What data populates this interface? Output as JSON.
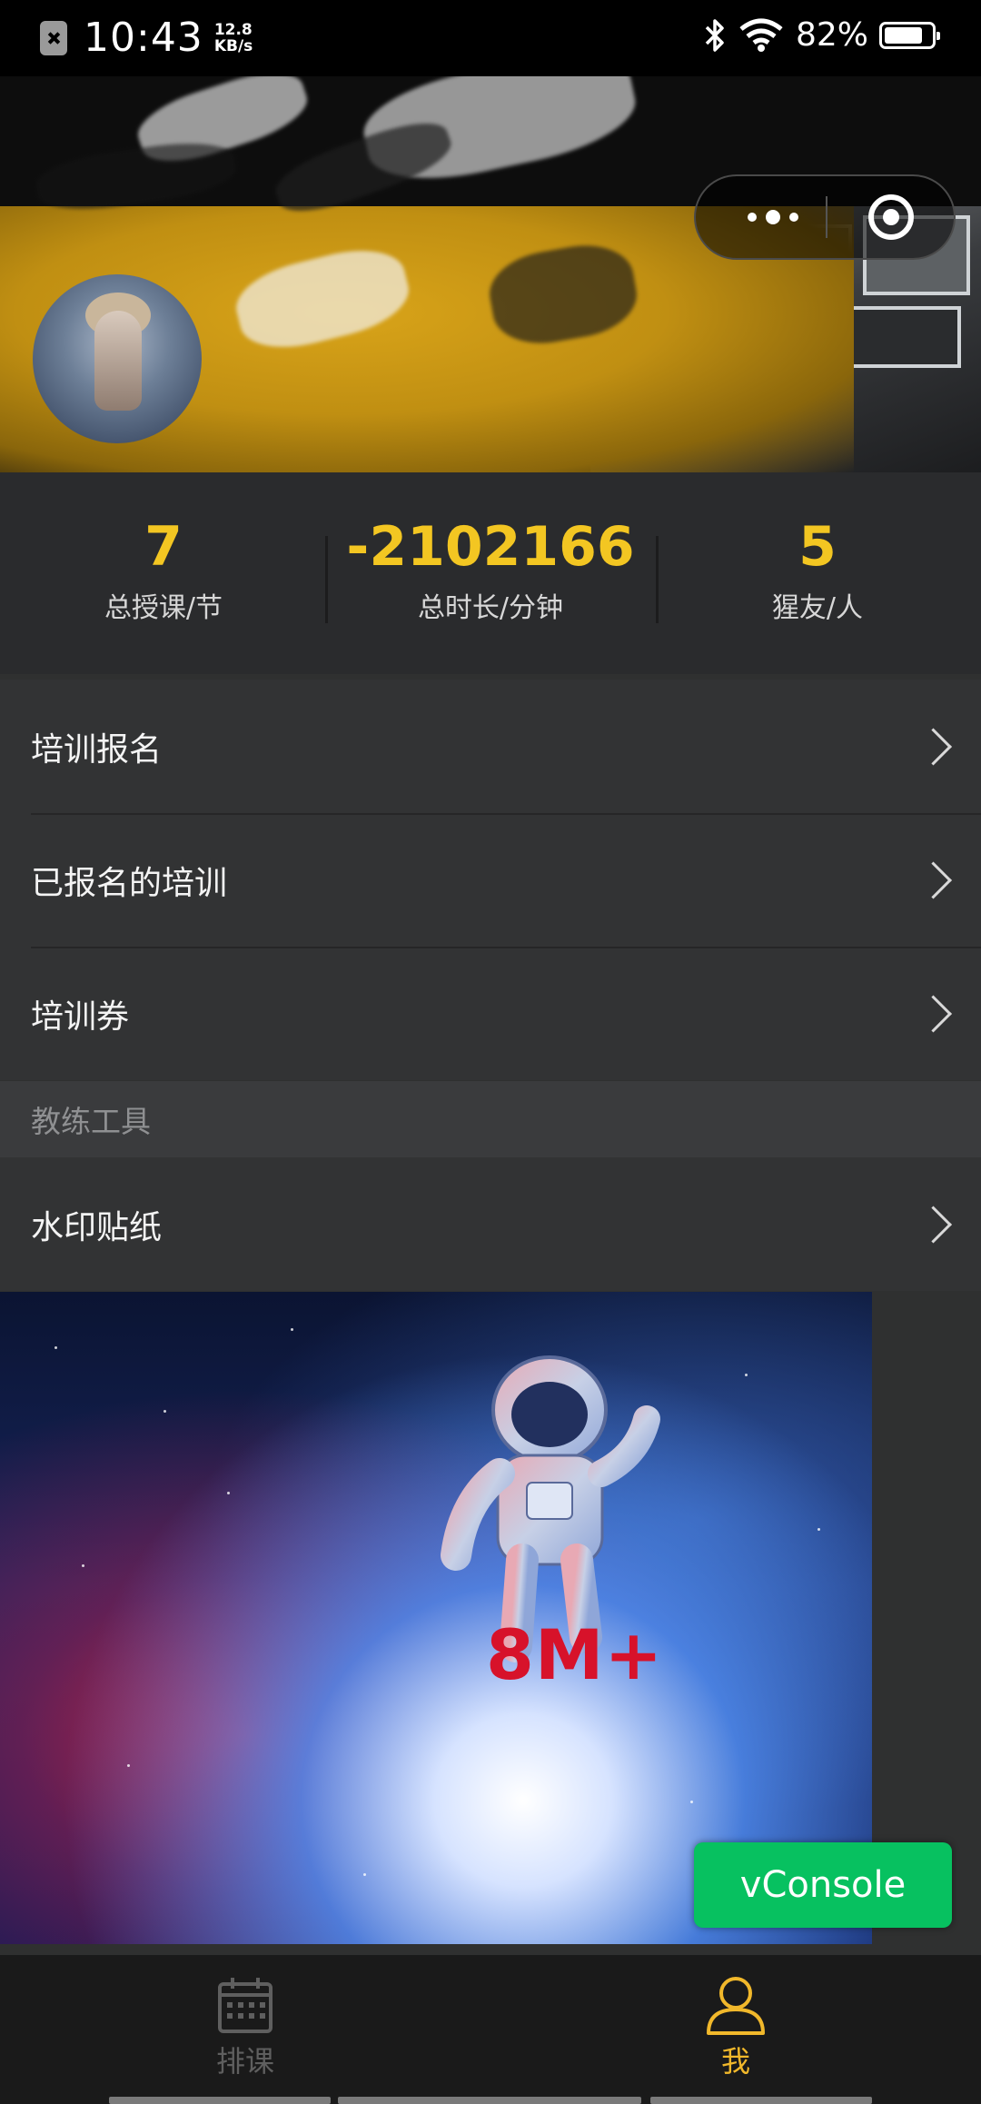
{
  "status_bar": {
    "time": "10:43",
    "net_speed_value": "12.8",
    "net_speed_unit": "KB/s",
    "battery_percent": "82%",
    "battery_level": 0.82
  },
  "capsule": {
    "more_icon": "more-dots-icon",
    "close_icon": "target-circle-icon"
  },
  "stats": [
    {
      "value": "7",
      "label": "总授课/节"
    },
    {
      "value": "-2102166",
      "label": "总时长/分钟"
    },
    {
      "value": "5",
      "label": "猩友/人"
    }
  ],
  "menu": {
    "items": [
      {
        "label": "培训报名"
      },
      {
        "label": "已报名的培训"
      },
      {
        "label": "培训券"
      }
    ],
    "section_title": "教练工具",
    "tool_items": [
      {
        "label": "水印贴纸"
      }
    ]
  },
  "promo": {
    "text": "8M+"
  },
  "vconsole": {
    "label": "vConsole"
  },
  "tabbar": {
    "tabs": [
      {
        "label": "排课",
        "icon": "calendar-icon",
        "active": false
      },
      {
        "label": "我",
        "icon": "person-icon",
        "active": true
      }
    ],
    "active_color": "#f1b82b",
    "inactive_color": "#5f5f5f"
  },
  "colors": {
    "accent": "#f3c622",
    "vconsole_green": "#07c160",
    "promo_text": "#d7122a"
  }
}
